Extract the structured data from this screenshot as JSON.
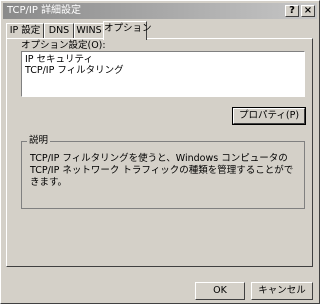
{
  "window": {
    "title": "TCP/IP 詳細設定",
    "help_button": "?",
    "close_button": "×"
  },
  "tabs": [
    {
      "label": "IP 設定"
    },
    {
      "label": "DNS"
    },
    {
      "label": "WINS"
    },
    {
      "label": "オプション",
      "active": true
    }
  ],
  "options": {
    "label": "オプション設定(O):",
    "items": [
      "IP セキュリティ",
      "TCP/IP フィルタリング"
    ],
    "selected_index": 1
  },
  "properties_button": "プロパティ(P)",
  "description": {
    "legend": "説明",
    "text": "TCP/IP フィルタリングを使うと、Windows コンピュータの TCP/IP ネットワーク トラフィックの種類を管理することができます。"
  },
  "footer": {
    "ok": "OK",
    "cancel": "キャンセル"
  }
}
